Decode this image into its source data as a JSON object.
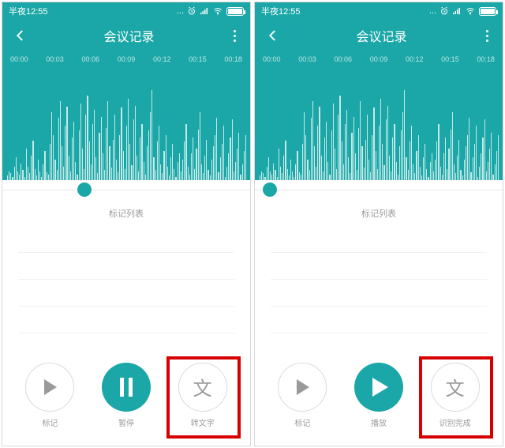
{
  "status_time": "半夜12:55",
  "page_title": "会议记录",
  "timeline": [
    "00:00",
    "00:03",
    "00:06",
    "00:09",
    "00:12",
    "00:15",
    "00:18"
  ],
  "marklist_title": "标记列表",
  "left": {
    "thumb_pct": 33,
    "btn1": "标记",
    "btn2": "暂停",
    "btn3": "转文字"
  },
  "right": {
    "thumb_pct": 6,
    "btn1": "标记",
    "btn2": "播放",
    "btn3": "识别完成"
  },
  "wave_heights": [
    4,
    8,
    6,
    3,
    12,
    20,
    8,
    5,
    15,
    9,
    3,
    28,
    12,
    6,
    22,
    35,
    10,
    4,
    18,
    8,
    3,
    14,
    26,
    7,
    5,
    32,
    60,
    40,
    18,
    9,
    55,
    70,
    30,
    12,
    48,
    65,
    22,
    8,
    38,
    52,
    16,
    5,
    44,
    68,
    28,
    10,
    58,
    75,
    34,
    14,
    50,
    62,
    20,
    6,
    42,
    56,
    24,
    9,
    46,
    70,
    30,
    11,
    36,
    58,
    18,
    7,
    40,
    64,
    26,
    10,
    48,
    72,
    32,
    13,
    54,
    66,
    22,
    8,
    38,
    50,
    16,
    5,
    30,
    44,
    60,
    80,
    20,
    9,
    34,
    48,
    14,
    6,
    26,
    40,
    12,
    4,
    20,
    32,
    10,
    3,
    16,
    24,
    8,
    18,
    34,
    50,
    12,
    5,
    24,
    38,
    10,
    28,
    45,
    60,
    14,
    6,
    22,
    36,
    9,
    4,
    18,
    30,
    40,
    55,
    7,
    20,
    32,
    48,
    3,
    12,
    24,
    38,
    54,
    8,
    16,
    28,
    42,
    5,
    14,
    26,
    40
  ]
}
